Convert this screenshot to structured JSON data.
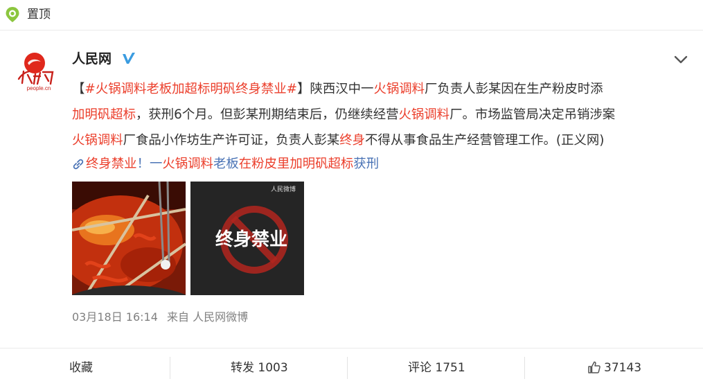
{
  "pinned": {
    "label": "置顶"
  },
  "author": {
    "name": "人民网",
    "verified": true,
    "avatar_caption": "people.cn"
  },
  "post": {
    "line1": [
      {
        "t": "【",
        "s": "n"
      },
      {
        "t": "#火锅调料老板加超标明矾终身禁业#",
        "s": "tag"
      },
      {
        "t": "】陕西汉中一",
        "s": "n"
      },
      {
        "t": "火锅调料",
        "s": "hl"
      },
      {
        "t": "厂负责人彭某因在生产粉皮时添",
        "s": "n"
      }
    ],
    "line2": [
      {
        "t": "加明矾超标",
        "s": "hl"
      },
      {
        "t": "，获刑6个月。但彭某刑期结束后，仍继续经营",
        "s": "n"
      },
      {
        "t": "火锅调料",
        "s": "hl"
      },
      {
        "t": "厂。市场监管局决定吊销涉案",
        "s": "n"
      }
    ],
    "line3": [
      {
        "t": "火锅调料",
        "s": "hl"
      },
      {
        "t": "厂食品小作坊生产许可证，负责人彭某",
        "s": "n"
      },
      {
        "t": "终身",
        "s": "hl"
      },
      {
        "t": "不得从事食品生产经营管理工作。(正义网)",
        "s": "n"
      }
    ],
    "link_parts": [
      {
        "t": "终身禁业",
        "s": "hl"
      },
      {
        "t": "！一",
        "s": "n"
      },
      {
        "t": "火锅调料",
        "s": "hl"
      },
      {
        "t": "老板",
        "s": "n"
      },
      {
        "t": "在粉皮里",
        "s": "hl"
      },
      {
        "t": "加明矾超标",
        "s": "hl"
      },
      {
        "t": "获刑",
        "s": "n"
      }
    ],
    "image2_caption": "终身禁业",
    "image2_watermark": "人民微博"
  },
  "meta": {
    "time": "03月18日 16:14",
    "source": "来自 人民网微博"
  },
  "actions": {
    "favorite": "收藏",
    "repost": "转发 1003",
    "comment": "评论 1751",
    "like": "37143"
  },
  "colors": {
    "highlight": "#eb3f2c",
    "link": "#4a73b5",
    "pin": "#8cc63f"
  },
  "icons": [
    "pin-location-icon",
    "verified-icon",
    "chevron-down-icon",
    "link-icon",
    "thumbs-up-icon"
  ]
}
